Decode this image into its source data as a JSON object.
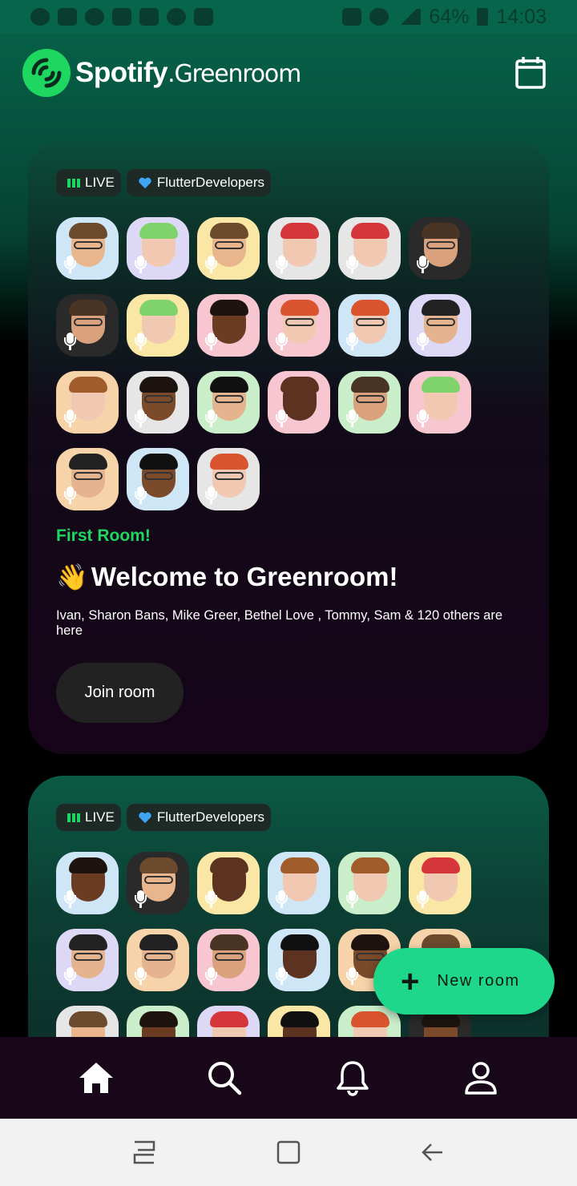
{
  "status_bar": {
    "battery": "64%",
    "time": "14:03"
  },
  "header": {
    "brand_bold": "Spotify",
    "brand_light": ".Greenroom",
    "calendar_icon": "calendar-icon"
  },
  "colors": {
    "accent": "#1ed760",
    "fab": "#1ed78a",
    "nav_bg": "#170718"
  },
  "rooms": [
    {
      "tags": {
        "live": "LIVE",
        "club": "FlutterDevelopers"
      },
      "avatars": [
        {
          "bg": "#cfe6f7",
          "skin": "#e9b58c",
          "hair": "#6b4a2e",
          "glasses": true
        },
        {
          "bg": "#ded8f7",
          "skin": "#f1c9b3",
          "hair": "#7fd36a",
          "glasses": false
        },
        {
          "bg": "#fbe7a5",
          "skin": "#e9b58c",
          "hair": "#6b4a2e",
          "glasses": true
        },
        {
          "bg": "#e6e6e6",
          "skin": "#f1c9b3",
          "hair": "#d4363a",
          "glasses": false
        },
        {
          "bg": "#e6e6e6",
          "skin": "#f1c9b3",
          "hair": "#d4363a",
          "glasses": false
        },
        {
          "bg": "#2a2a2a",
          "skin": "#d9a27c",
          "hair": "#4a3525",
          "glasses": true
        },
        {
          "bg": "#2a2a2a",
          "skin": "#d9a27c",
          "hair": "#4a3525",
          "glasses": true
        },
        {
          "bg": "#fbe7a5",
          "skin": "#f1c9b3",
          "hair": "#7fd36a",
          "glasses": false
        },
        {
          "bg": "#f7c6d0",
          "skin": "#6b3b22",
          "hair": "#1d1410",
          "glasses": false
        },
        {
          "bg": "#f7c6d0",
          "skin": "#f1c9b3",
          "hair": "#d9542f",
          "glasses": true
        },
        {
          "bg": "#cfe6f7",
          "skin": "#f1c9b3",
          "hair": "#d9542f",
          "glasses": true
        },
        {
          "bg": "#ded8f7",
          "skin": "#e5b38e",
          "hair": "#222",
          "glasses": true
        },
        {
          "bg": "#f6d3a8",
          "skin": "#f1c9b3",
          "hair": "#a15c2c",
          "glasses": false
        },
        {
          "bg": "#e6e6e6",
          "skin": "#7a4a2a",
          "hair": "#1d1410",
          "glasses": true
        },
        {
          "bg": "#c9eec9",
          "skin": "#e5b38e",
          "hair": "#111",
          "glasses": true
        },
        {
          "bg": "#f7c6d0",
          "skin": "#5b3320",
          "hair": "#5b3320",
          "glasses": false
        },
        {
          "bg": "#c9eec9",
          "skin": "#d9a27c",
          "hair": "#4a3525",
          "glasses": true
        },
        {
          "bg": "#f7c6d0",
          "skin": "#f1c9b3",
          "hair": "#7fd36a",
          "glasses": false
        },
        {
          "bg": "#f6d3a8",
          "skin": "#e5b38e",
          "hair": "#222",
          "glasses": true
        },
        {
          "bg": "#cfe6f7",
          "skin": "#7a4a2a",
          "hair": "#111",
          "glasses": true
        },
        {
          "bg": "#e6e6e6",
          "skin": "#f1c9b3",
          "hair": "#d9542f",
          "glasses": true
        }
      ],
      "first_room_label": "First Room!",
      "title": "Welcome to Greenroom!",
      "title_emoji": "👋",
      "members_text": "Ivan, Sharon Bans, Mike Greer, Bethel Love , Tommy, Sam & 120 others are here",
      "join_label": "Join room"
    },
    {
      "tags": {
        "live": "LIVE",
        "club": "FlutterDevelopers"
      },
      "avatars": [
        {
          "bg": "#cfe6f7",
          "skin": "#6b3b22",
          "hair": "#1d1410",
          "glasses": false
        },
        {
          "bg": "#2a2a2a",
          "skin": "#e9b58c",
          "hair": "#6b4a2e",
          "glasses": true
        },
        {
          "bg": "#fbe7a5",
          "skin": "#5b3320",
          "hair": "#5b3320",
          "glasses": false
        },
        {
          "bg": "#cfe6f7",
          "skin": "#f1c9b3",
          "hair": "#a15c2c",
          "glasses": false
        },
        {
          "bg": "#c9eec9",
          "skin": "#f1c9b3",
          "hair": "#a15c2c",
          "glasses": false
        },
        {
          "bg": "#fbe7a5",
          "skin": "#f1c9b3",
          "hair": "#d4363a",
          "glasses": false
        },
        {
          "bg": "#ded8f7",
          "skin": "#e5b38e",
          "hair": "#222",
          "glasses": true
        },
        {
          "bg": "#f6d3a8",
          "skin": "#e5b38e",
          "hair": "#222",
          "glasses": true
        },
        {
          "bg": "#f7c6d0",
          "skin": "#d9a27c",
          "hair": "#4a3525",
          "glasses": true
        },
        {
          "bg": "#cfe6f7",
          "skin": "#5b3320",
          "hair": "#111",
          "glasses": false
        },
        {
          "bg": "#f6d3a8",
          "skin": "#7a4a2a",
          "hair": "#1d1410",
          "glasses": true
        },
        {
          "bg": "#f6d3a8",
          "skin": "#e5b38e",
          "hair": "#6b4a2e",
          "glasses": false
        },
        {
          "bg": "#e6e6e6",
          "skin": "#e9b58c",
          "hair": "#6b4a2e",
          "glasses": false
        },
        {
          "bg": "#c9eec9",
          "skin": "#6b3b22",
          "hair": "#1d1410",
          "glasses": false
        },
        {
          "bg": "#ded8f7",
          "skin": "#f1c9b3",
          "hair": "#d4363a",
          "glasses": false
        },
        {
          "bg": "#fbe7a5",
          "skin": "#5b3320",
          "hair": "#111",
          "glasses": false
        },
        {
          "bg": "#c9eec9",
          "skin": "#f1c9b3",
          "hair": "#d9542f",
          "glasses": false
        },
        {
          "bg": "#2a2a2a",
          "skin": "#7a4a2a",
          "hair": "#1d1410",
          "glasses": false
        }
      ]
    }
  ],
  "fab": {
    "label": "New room",
    "icon": "plus-icon"
  },
  "bottom_nav": {
    "items": [
      "home-icon",
      "search-icon",
      "bell-icon",
      "profile-icon"
    ],
    "active": "home-icon"
  },
  "system_nav": {
    "items": [
      "recent-apps-icon",
      "home-square-icon",
      "back-arrow-icon"
    ]
  }
}
